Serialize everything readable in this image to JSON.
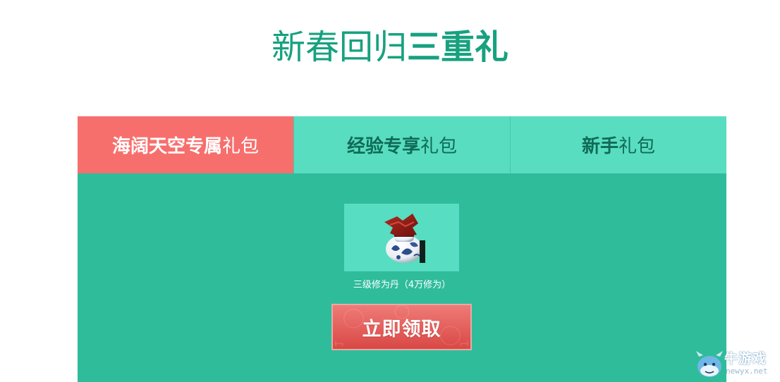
{
  "header": {
    "title_part1": "新春回归",
    "title_part2": "三重礼"
  },
  "tabs": [
    {
      "bold": "海阔天空专属",
      "normal": "礼包",
      "active": true
    },
    {
      "bold": "经验专享",
      "normal": "礼包",
      "active": false
    },
    {
      "bold": "新手",
      "normal": "礼包",
      "active": false
    }
  ],
  "reward": {
    "icon": "pill-jar-icon",
    "name": "三级修为丹（4万修为）"
  },
  "claim_button": {
    "label": "立即领取"
  },
  "watermark": {
    "brand": "牛游戏",
    "domain": "newyx.net"
  },
  "colors": {
    "title": "#17a17f",
    "panel_bg": "#2fbc9b",
    "tab_inactive": "#59ddc1",
    "tab_active": "#f66f6d",
    "button": "#d94845"
  }
}
